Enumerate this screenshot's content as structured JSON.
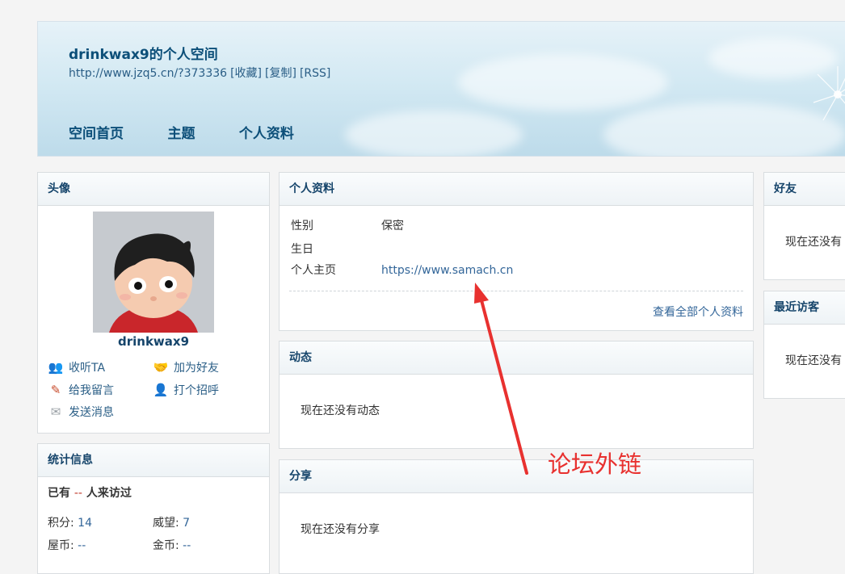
{
  "header": {
    "title": "drinkwax9的个人空间",
    "url": "http://www.jzq5.cn/?373336",
    "links": [
      "[收藏]",
      "[复制]",
      "[RSS]"
    ],
    "nav": [
      "空间首页",
      "主题",
      "个人资料"
    ]
  },
  "avatar_panel": {
    "title": "头像",
    "username": "drinkwax9",
    "actions": [
      {
        "label": "收听TA",
        "icon": "follow-icon"
      },
      {
        "label": "加为好友",
        "icon": "handshake-icon"
      },
      {
        "label": "给我留言",
        "icon": "pencil-icon"
      },
      {
        "label": "打个招呼",
        "icon": "greet-icon"
      },
      {
        "label": "发送消息",
        "icon": "envelope-icon"
      }
    ]
  },
  "stats_panel": {
    "title": "统计信息",
    "visitors_prefix": "已有",
    "visitors_value": "--",
    "visitors_suffix": "人来访过",
    "items": [
      {
        "label": "积分:",
        "value": "14"
      },
      {
        "label": "威望:",
        "value": "7"
      },
      {
        "label": "屋币:",
        "value": "--"
      },
      {
        "label": "金币:",
        "value": "--"
      }
    ]
  },
  "profile_panel": {
    "title": "个人资料",
    "rows": [
      {
        "key": "性别",
        "value": "保密"
      },
      {
        "key": "生日",
        "value": ""
      },
      {
        "key": "个人主页",
        "value": "https://www.samach.cn"
      }
    ],
    "view_all": "查看全部个人资料"
  },
  "feed_panel": {
    "title": "动态",
    "empty": "现在还没有动态"
  },
  "share_panel": {
    "title": "分享",
    "empty": "现在还没有分享"
  },
  "friends_panel": {
    "title": "好友",
    "empty": "现在还没有"
  },
  "visitors_panel": {
    "title": "最近访客",
    "empty": "现在还没有"
  },
  "annotation": {
    "text": "论坛外链",
    "color": "#e8312f"
  }
}
